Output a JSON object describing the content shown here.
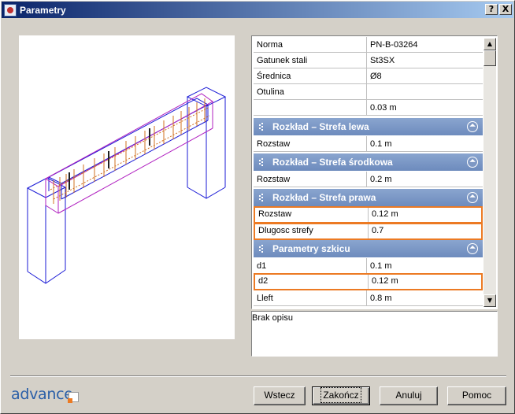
{
  "window": {
    "title": "Parametry",
    "help_glyph": "?",
    "close_glyph": "X"
  },
  "rows": [
    {
      "key": "Norma",
      "value": "PN-B-03264"
    },
    {
      "key": "Gatunek stali",
      "value": "St3SX"
    },
    {
      "key": "Średnica",
      "value": "Ø8"
    },
    {
      "key": "Otulina",
      "value": ""
    },
    {
      "key": "",
      "value": "0.03 m"
    }
  ],
  "sections": [
    {
      "title": "Rozkład – Strefa lewa",
      "rows": [
        {
          "key": "Rozstaw",
          "value": "0.1 m"
        }
      ]
    },
    {
      "title": "Rozkład – Strefa środkowa",
      "rows": [
        {
          "key": "Rozstaw",
          "value": "0.2 m"
        }
      ]
    },
    {
      "title": "Rozkład – Strefa prawa",
      "rows": [
        {
          "key": "Rozstaw",
          "value": "0.12 m"
        },
        {
          "key": "Dlugosc strefy",
          "value": "0.7"
        }
      ]
    },
    {
      "title": "Parametry szkicu",
      "rows": [
        {
          "key": "d1",
          "value": "0.1 m"
        },
        {
          "key": "d2",
          "value": "0.12 m"
        },
        {
          "key": "Lleft",
          "value": "0.8 m"
        }
      ]
    }
  ],
  "description": "Brak opisu",
  "logo": "advance",
  "buttons": {
    "back": "Wstecz",
    "finish": "Zakończ",
    "cancel": "Anuluj",
    "help": "Pomoc"
  },
  "icons": {
    "collapse": "⏶",
    "scroll_up": "▲",
    "scroll_down": "▼"
  },
  "colors": {
    "highlight": "#ec7a23",
    "section_bg": "#7e98c4",
    "structure": "#1a1ad6",
    "stirrups": "#b020c0",
    "rebar": "#d07020"
  }
}
